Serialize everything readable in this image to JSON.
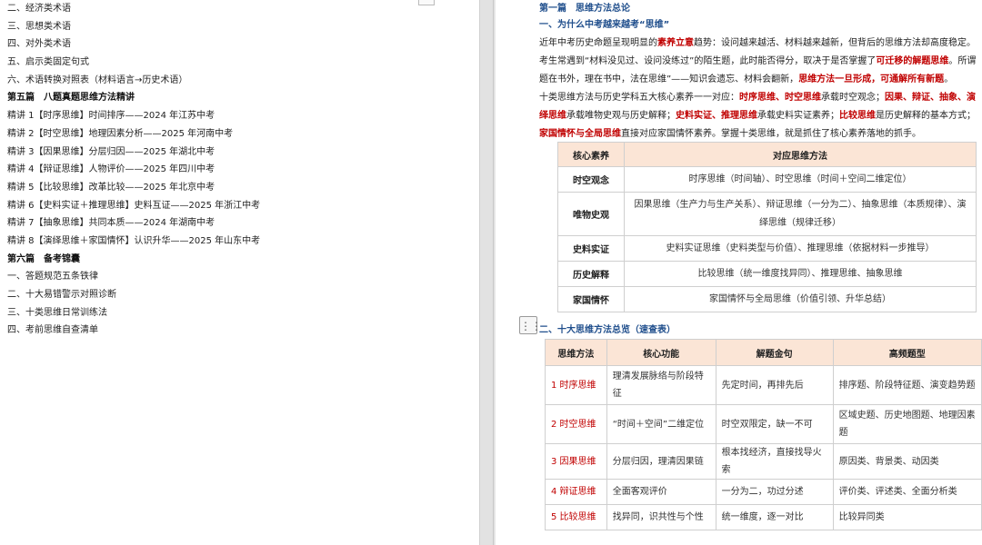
{
  "outline": [
    {
      "text": "二、经济类术语",
      "h": false
    },
    {
      "text": "三、思想类术语",
      "h": false
    },
    {
      "text": "四、对外类术语",
      "h": false
    },
    {
      "text": "五、启示类固定句式",
      "h": false
    },
    {
      "text": "六、术语转换对照表（材料语言→历史术语）",
      "h": false
    },
    {
      "text": "第五篇　八题真题思维方法精讲",
      "h": true
    },
    {
      "text": "精讲 1【时序思维】时间排序——2024 年江苏中考",
      "h": false
    },
    {
      "text": "精讲 2【时空思维】地理因素分析——2025 年河南中考",
      "h": false
    },
    {
      "text": "精讲 3【因果思维】分层归因——2025 年湖北中考",
      "h": false
    },
    {
      "text": "精讲 4【辩证思维】人物评价——2025 年四川中考",
      "h": false
    },
    {
      "text": "精讲 5【比较思维】改革比较——2025 年北京中考",
      "h": false
    },
    {
      "text": "精讲 6【史料实证＋推理思维】史料互证——2025 年浙江中考",
      "h": false
    },
    {
      "text": "精讲 7【抽象思维】共同本质——2024 年湖南中考",
      "h": false
    },
    {
      "text": "精讲 8【演绎思维＋家国情怀】认识升华——2025 年山东中考",
      "h": false
    },
    {
      "text": "第六篇　备考锦囊",
      "h": true
    },
    {
      "text": "一、答题规范五条铁律",
      "h": false
    },
    {
      "text": "二、十大易错警示对照诊断",
      "h": false
    },
    {
      "text": "三、十类思维日常训练法",
      "h": false
    },
    {
      "text": "四、考前思维自查清单",
      "h": false
    }
  ],
  "doc": {
    "part_title": "第一篇　思维方法总论",
    "section1": "一、为什么中考越来越考“思维”",
    "p1_a": "近年中考历史命题呈现明显的",
    "p1_b": "素养立意",
    "p1_c": "趋势：设问越来越活、材料越来越新，但背后的思维方法却高度稳定。",
    "p2_a": "考生常遇到“材料没见过、设问没练过”的陌生题，此时能否得分，取决于是否掌握了",
    "p2_b": "可迁移的解题思维",
    "p2_c": "。所谓",
    "p3_a": "题在书外，理在书中，法在思维”——知识会遗忘、材料会翻新，",
    "p3_b": "思维方法一旦形成，可通解所有新题",
    "p3_c": "。",
    "p4_a": "十类思维方法与历史学科五大核心素养一一对应：",
    "p4_b": "时序思维、时空思维",
    "p4_c": "承载时空观念；",
    "p4_d": "因果、辩证、抽象、演",
    "p5_a": "绎思维",
    "p5_b": "承载唯物史观与历史解释；",
    "p5_c": "史料实证、推理思维",
    "p5_d": "承载史料实证素养；",
    "p5_e": "比较思维",
    "p5_f": "是历史解释的基本方式；",
    "p6_a": "家国情怀与全局思维",
    "p6_b": "直接对应家国情怀素养。掌握十类思维，就是抓住了核心素养落地的抓手。",
    "section2": "二、十大思维方法总览（速查表）"
  },
  "table1": {
    "headers": [
      "核心素养",
      "对应思维方法"
    ],
    "rows": [
      {
        "k": "时空观念",
        "v": "时序思维（时间轴）、时空思维（时间＋空间二维定位）"
      },
      {
        "k": "唯物史观",
        "v": "因果思维（生产力与生产关系）、辩证思维（一分为二）、抽象思维（本质规律）、演绎思维（规律迁移）"
      },
      {
        "k": "史料实证",
        "v": "史料实证思维（史料类型与价值）、推理思维（依据材料一步推导）"
      },
      {
        "k": "历史解释",
        "v": "比较思维（统一维度找异同）、推理思维、抽象思维"
      },
      {
        "k": "家国情怀",
        "v": "家国情怀与全局思维（价值引领、升华总结）"
      }
    ]
  },
  "table2": {
    "headers": [
      "思维方法",
      "核心功能",
      "解题金句",
      "高频题型"
    ],
    "rows": [
      {
        "m": "1 时序思维",
        "f": "理清发展脉络与阶段特征",
        "s": "先定时间，再排先后",
        "q": "排序题、阶段特征题、演变趋势题"
      },
      {
        "m": "2 时空思维",
        "f": "“时间＋空间”二维定位",
        "s": "时空双限定，缺一不可",
        "q": "区域史题、历史地图题、地理因素题"
      },
      {
        "m": "3 因果思维",
        "f": "分层归因，理清因果链",
        "s": "根本找经济，直接找导火索",
        "q": "原因类、背景类、动因类"
      },
      {
        "m": "4 辩证思维",
        "f": "全面客观评价",
        "s": "一分为二，功过分述",
        "q": "评价类、评述类、全面分析类"
      },
      {
        "m": "5 比较思维",
        "f": "找异同，识共性与个性",
        "s": "统一维度，逐一对比",
        "q": "比较异同类"
      }
    ]
  },
  "ui": {
    "handle_icon": "⋮⋮"
  }
}
